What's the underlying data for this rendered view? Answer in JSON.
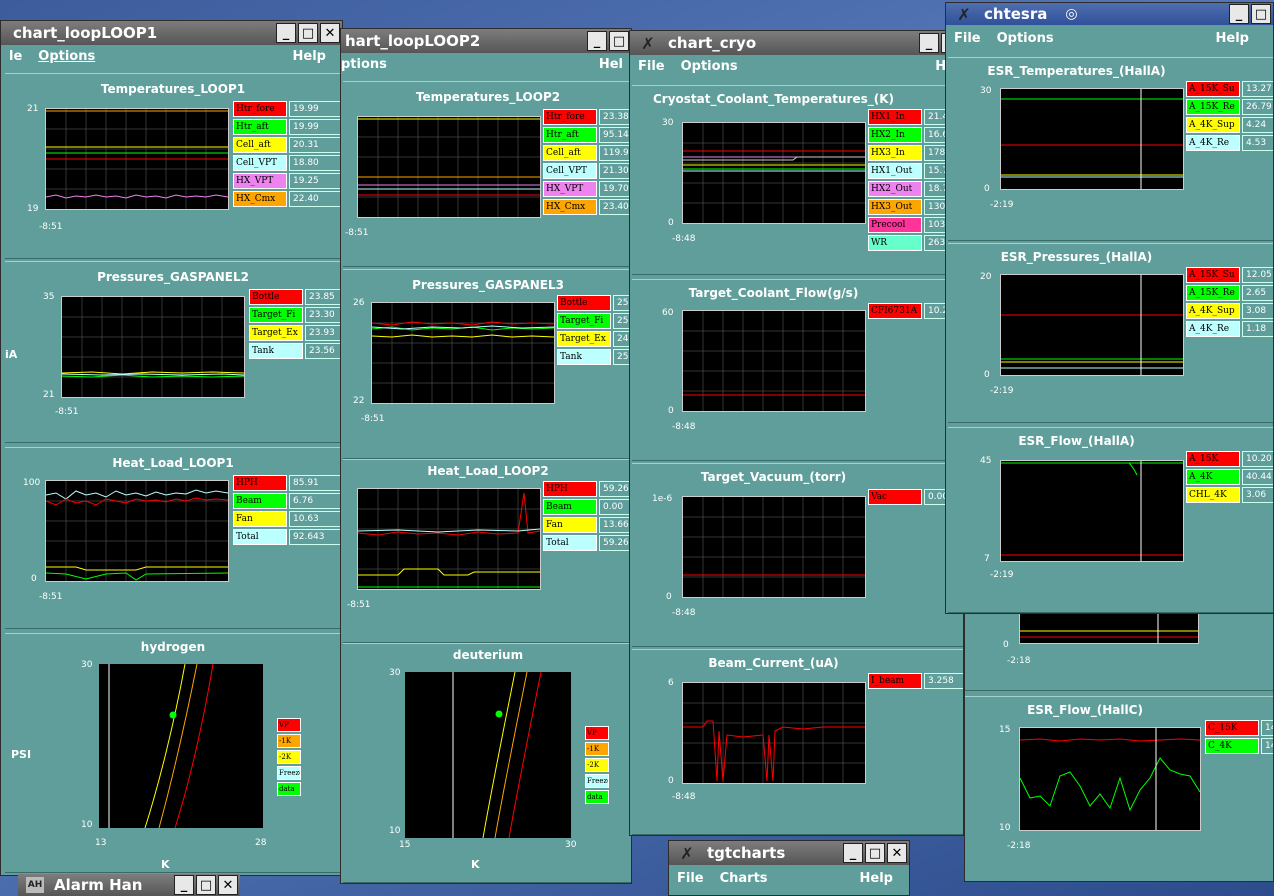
{
  "colors": {
    "teal": "#5f9e9a",
    "red": "#ff0000",
    "green": "#00ff00",
    "yellow": "#ffff00",
    "cyan": "#bff",
    "violet": "#ee82ee",
    "orange": "#ffa500",
    "aqua": "#66ffcc",
    "pink": "#ff3399"
  },
  "win1": {
    "title": "chart_loopLOOP1",
    "menu": {
      "file": "le",
      "options": "Options",
      "help": "Help"
    },
    "temps": {
      "title": "Temperatures_LOOP1",
      "ymax": "21",
      "ymin": "19",
      "xlab": "-8:51",
      "legend": [
        {
          "n": "Htr_fore",
          "v": "19.99",
          "c": "#ff0000"
        },
        {
          "n": "Htr_aft",
          "v": "19.99",
          "c": "#00ff00"
        },
        {
          "n": "Cell_aft",
          "v": "20.31",
          "c": "#ffff00"
        },
        {
          "n": "Cell_VPT",
          "v": "18.80",
          "c": "#bff"
        },
        {
          "n": "HX_VPT",
          "v": "19.25",
          "c": "#ee82ee"
        },
        {
          "n": "HX_Cmx",
          "v": "22.40",
          "c": "#ffa500"
        }
      ]
    },
    "press": {
      "title": "Pressures_GASPANEL2",
      "ymax": "35",
      "ymin": "21",
      "xlab": "-8:51",
      "side": "iA",
      "legend": [
        {
          "n": "Bottle",
          "v": "23.85",
          "c": "#ff0000"
        },
        {
          "n": "Target_Fi",
          "v": "23.30",
          "c": "#00ff00"
        },
        {
          "n": "Target_Ex",
          "v": "23.93",
          "c": "#ffff00"
        },
        {
          "n": "Tank",
          "v": "23.56",
          "c": "#bff"
        }
      ]
    },
    "heat": {
      "title": "Heat_Load_LOOP1",
      "ymax": "100",
      "ymin": "0",
      "xlab": "-8:51",
      "legend": [
        {
          "n": "HPH",
          "v": "85.91",
          "c": "#ff0000"
        },
        {
          "n": "Beam",
          "v": "6.76",
          "c": "#00ff00"
        },
        {
          "n": "Fan",
          "v": "10.63",
          "c": "#ffff00"
        },
        {
          "n": "Total",
          "v": "92.643",
          "c": "#bff"
        }
      ]
    },
    "phase": {
      "title": "hydrogen",
      "ymax": "30",
      "ymin": "10",
      "xmin": "13",
      "xmax": "28",
      "xlabel": "K",
      "ylabel": "PSI",
      "legend": [
        {
          "n": "VP",
          "c": "#ff0000"
        },
        {
          "n": "-1K",
          "c": "#ffa500"
        },
        {
          "n": "-2K",
          "c": "#ffff00"
        },
        {
          "n": "Freeze",
          "c": "#bff"
        },
        {
          "n": "data",
          "c": "#00ff00"
        }
      ]
    }
  },
  "win2": {
    "title": "hart_loopLOOP2",
    "menu": {
      "options": "ptions",
      "help": "Hel"
    },
    "temps": {
      "title": "Temperatures_LOOP2",
      "xlab": "-8:51",
      "legend": [
        {
          "n": "Htr_fore",
          "v": "23.38",
          "c": "#ff0000"
        },
        {
          "n": "Htr_aft",
          "v": "95.14",
          "c": "#00ff00"
        },
        {
          "n": "Cell_aft",
          "v": "119.99",
          "c": "#ffff00"
        },
        {
          "n": "Cell_VPT",
          "v": "21.30",
          "c": "#bff"
        },
        {
          "n": "HX_VPT",
          "v": "19.70",
          "c": "#ee82ee"
        },
        {
          "n": "HX_Cmx",
          "v": "23.40",
          "c": "#ffa500"
        }
      ]
    },
    "press": {
      "title": "Pressures_GASPANEL3",
      "ymax": "26",
      "ymin": "22",
      "xlab": "-8:51",
      "legend": [
        {
          "n": "Bottle",
          "v": "25.28",
          "c": "#ff0000"
        },
        {
          "n": "Target_Fi",
          "v": "25.08",
          "c": "#00ff00"
        },
        {
          "n": "Target_Ex",
          "v": "24.76",
          "c": "#ffff00"
        },
        {
          "n": "Tank",
          "v": "25.12",
          "c": "#bff"
        }
      ]
    },
    "heat": {
      "title": "Heat_Load_LOOP2",
      "xlab": "-8:51",
      "legend": [
        {
          "n": "HPH",
          "v": "59.26",
          "c": "#ff0000"
        },
        {
          "n": "Beam",
          "v": "0.00",
          "c": "#00ff00"
        },
        {
          "n": "Fan",
          "v": "13.66",
          "c": "#ffff00"
        },
        {
          "n": "Total",
          "v": "59.261",
          "c": "#bff"
        }
      ]
    },
    "phase": {
      "title": "deuterium",
      "ymax": "30",
      "ymin": "10",
      "xmin": "15",
      "xmax": "30",
      "xlabel": "K",
      "legend": [
        {
          "n": "VP",
          "c": "#ff0000"
        },
        {
          "n": "-1K",
          "c": "#ffa500"
        },
        {
          "n": "-2K",
          "c": "#ffff00"
        },
        {
          "n": "Freeze",
          "c": "#bff"
        },
        {
          "n": "data",
          "c": "#00ff00"
        }
      ]
    }
  },
  "win3": {
    "title": "chart_cryo",
    "menu": {
      "file": "File",
      "options": "Options",
      "help": "He"
    },
    "coolant": {
      "title": "Cryostat_Coolant_Temperatures_(K)",
      "ymax": "30",
      "ymin": "0",
      "xlab": "-8:48",
      "legend": [
        {
          "n": "HX1_In",
          "v": "21.4",
          "c": "#ff0000"
        },
        {
          "n": "HX2_In",
          "v": "16.6",
          "c": "#00ff00"
        },
        {
          "n": "HX3_In",
          "v": "178.3",
          "c": "#ffff00"
        },
        {
          "n": "HX1_Out",
          "v": "15.7",
          "c": "#bff"
        },
        {
          "n": "HX2_Out",
          "v": "18.7",
          "c": "#ee82ee"
        },
        {
          "n": "HX3_Out",
          "v": "130.3",
          "c": "#ffa500"
        },
        {
          "n": "Precool",
          "v": "103.0",
          "c": "#ff3399"
        },
        {
          "n": "WR",
          "v": "263.3",
          "c": "#66ffcc"
        }
      ]
    },
    "flow": {
      "title": "Target_Coolant_Flow(g/s)",
      "ymax": "60",
      "ymin": "0",
      "xlab": "-8:48",
      "legend": [
        {
          "n": "CFI6731A",
          "v": "10.20",
          "c": "#ff0000"
        }
      ]
    },
    "vac": {
      "title": "Target_Vacuum_(torr)",
      "ymax": "1e-6",
      "ymin": "0",
      "xlab": "-8:48",
      "legend": [
        {
          "n": "Vac",
          "v": "0.0000",
          "c": "#ff0000"
        }
      ]
    },
    "beam": {
      "title": "Beam_Current_(uA)",
      "ymax": "6",
      "ymin": "0",
      "xlab": "-8:48",
      "legend": [
        {
          "n": "I_beam",
          "v": "3.258",
          "c": "#ff0000"
        }
      ]
    }
  },
  "win4": {
    "title": "chtesra",
    "menu": {
      "file": "File",
      "options": "Options",
      "help": "Help"
    },
    "temps": {
      "title": "ESR_Temperatures_(HallA)",
      "ymax": "30",
      "ymin": "0",
      "xlab": "-2:19",
      "legend": [
        {
          "n": "A_15K_Su",
          "v": "13.27",
          "c": "#ff0000"
        },
        {
          "n": "A_15K_Re",
          "v": "26.79",
          "c": "#00ff00"
        },
        {
          "n": "A_4K_Sup",
          "v": "4.24",
          "c": "#ffff00"
        },
        {
          "n": "A_4K_Re",
          "v": "4.53",
          "c": "#bff"
        }
      ]
    },
    "press": {
      "title": "ESR_Pressures_(HallA)",
      "ymax": "20",
      "ymin": "0",
      "xlab": "-2:19",
      "legend": [
        {
          "n": "A_15K_Su",
          "v": "12.05",
          "c": "#ff0000"
        },
        {
          "n": "A_15K_Re",
          "v": "2.65",
          "c": "#00ff00"
        },
        {
          "n": "A_4K_Sup",
          "v": "3.08",
          "c": "#ffff00"
        },
        {
          "n": "A_4K_Re",
          "v": "1.18",
          "c": "#bff"
        }
      ]
    },
    "flow": {
      "title": "ESR_Flow_(HallA)",
      "ymax": "45",
      "ymin": "7",
      "xlab": "-2:19",
      "legend": [
        {
          "n": "A_15K",
          "v": "10.20",
          "c": "#ff0000"
        },
        {
          "n": "A_4K",
          "v": "40.44",
          "c": "#00ff00"
        },
        {
          "n": "CHL_4K",
          "v": "3.06",
          "c": "#ffff00"
        }
      ]
    }
  },
  "win5": {
    "hidden_chart": {
      "ymin": "0",
      "xlab": "-2:18"
    },
    "flowc": {
      "title": "ESR_Flow_(HallC)",
      "ymax": "15",
      "ymin": "10",
      "xlab": "-2:18",
      "legend": [
        {
          "n": "C_15K",
          "v": "14.36",
          "c": "#ff0000"
        },
        {
          "n": "C_4K",
          "v": "14.19",
          "c": "#00ff00"
        }
      ]
    }
  },
  "win6": {
    "title": "tgtcharts",
    "menu": {
      "file": "File",
      "charts": "Charts",
      "help": "Help"
    }
  },
  "win7": {
    "title": "Alarm Han"
  }
}
